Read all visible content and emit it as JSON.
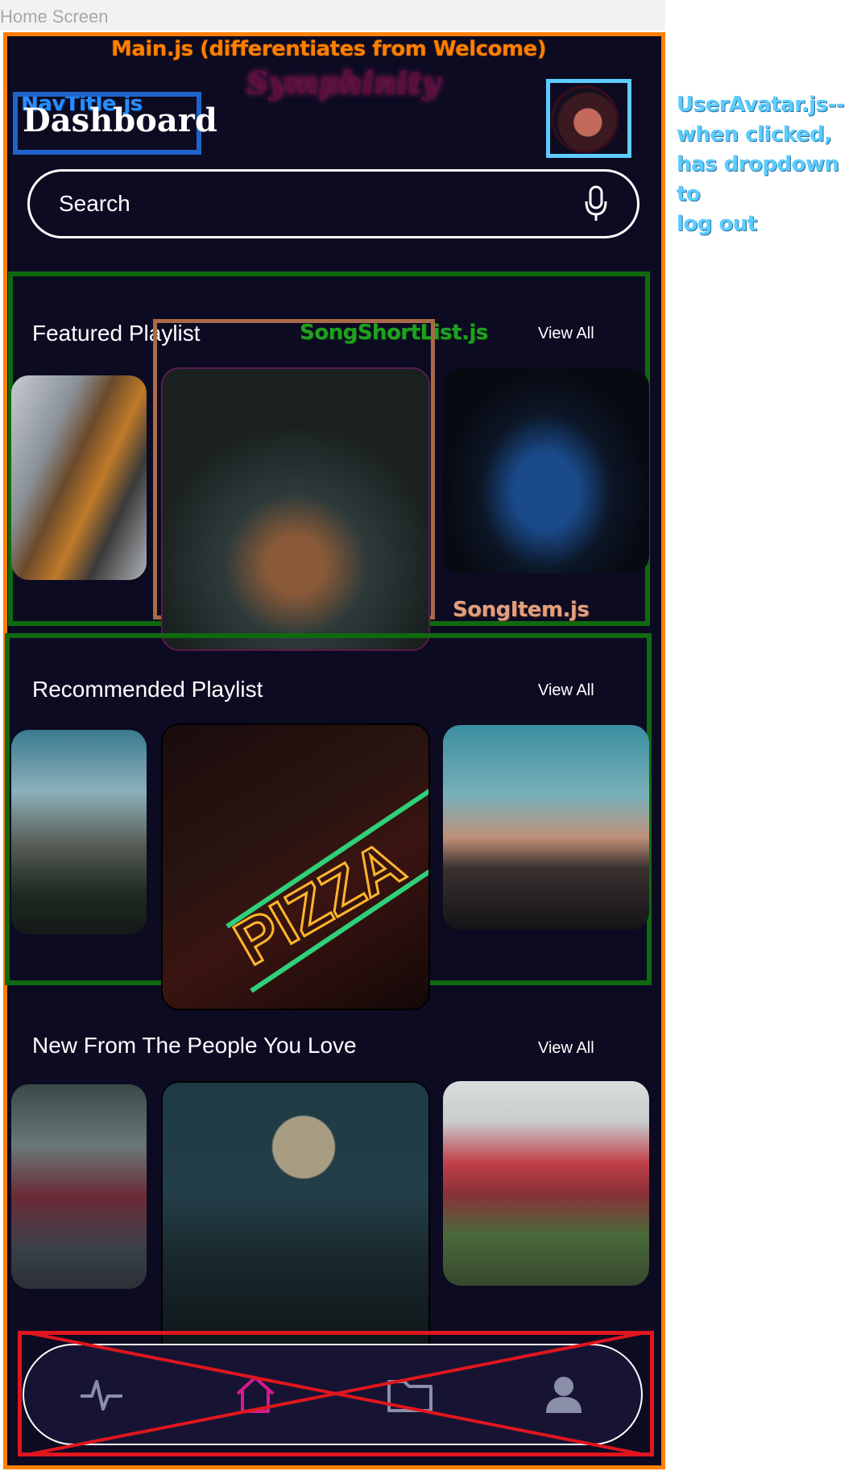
{
  "window": {
    "title": "Home Screen"
  },
  "annotations": {
    "main": "Main.js (differentiates from Welcome)",
    "navtitle": "NavTitle.js",
    "useravatar": [
      "UserAvatar.js--",
      "when clicked,",
      "has dropdown to",
      "log out"
    ],
    "songshortlist": "SongShortList.js",
    "songitem": "SongItem.js"
  },
  "header": {
    "title": "Dashboard",
    "brand": "Symphinity"
  },
  "search": {
    "placeholder": "Search"
  },
  "sections": [
    {
      "title": "Featured Playlist",
      "view_all": "View All"
    },
    {
      "title": "Recommended Playlist",
      "view_all": "View All"
    },
    {
      "title": "New From The People You Love",
      "view_all": "View All"
    }
  ],
  "bottom_nav": {
    "icons": [
      "activity-icon",
      "home-icon",
      "folder-icon",
      "profile-icon"
    ],
    "active": "home-icon"
  },
  "colors": {
    "background": "#0c0b22",
    "accent": "#d61b8f",
    "main_border": "#ff7f00",
    "shortlist_border": "#0f6a0f",
    "avatar_border": "#5dccff",
    "navtitle_border": "#1f64c8",
    "songitem_border": "#a86a48",
    "crossed_out": "#e0161e"
  }
}
